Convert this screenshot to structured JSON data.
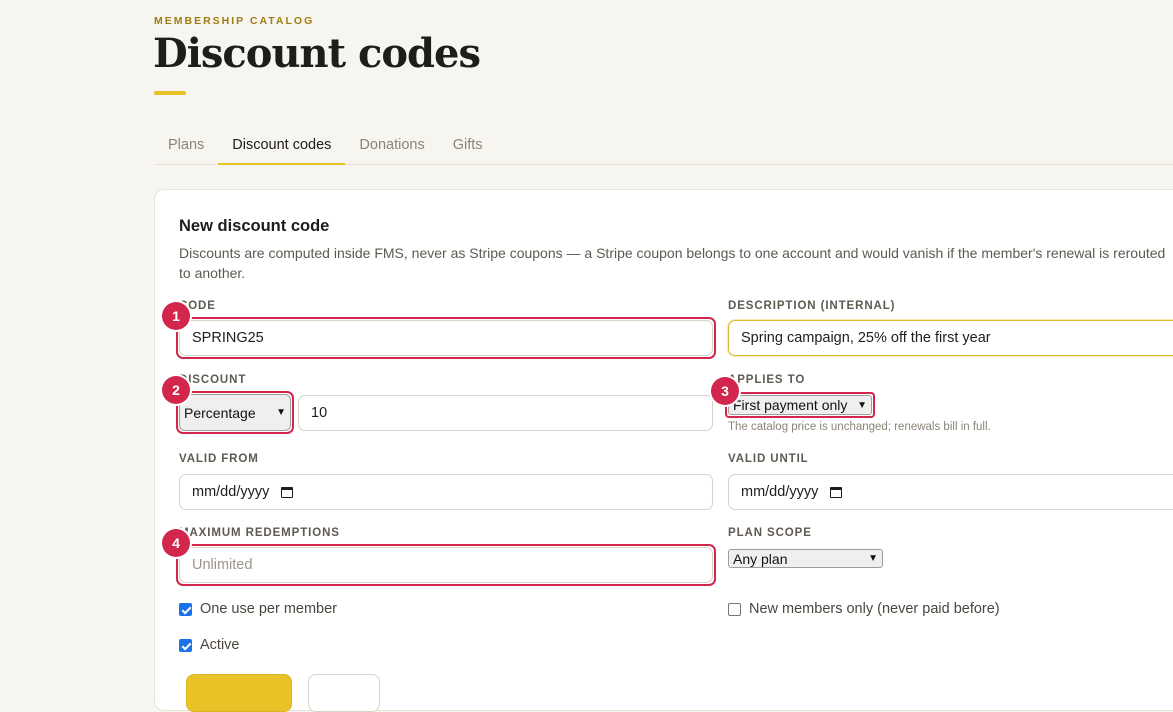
{
  "header": {
    "eyebrow": "MEMBERSHIP CATALOG",
    "title": "Discount codes"
  },
  "tabs": [
    {
      "label": "Plans",
      "active": false
    },
    {
      "label": "Discount codes",
      "active": true
    },
    {
      "label": "Donations",
      "active": false
    },
    {
      "label": "Gifts",
      "active": false
    }
  ],
  "form": {
    "title": "New discount code",
    "description": "Discounts are computed inside FMS, never as Stripe coupons — a Stripe coupon belongs to one account and would vanish if the member's renewal is rerouted to another.",
    "code": {
      "label": "CODE",
      "value": "SPRING25",
      "badge": "1"
    },
    "description_internal": {
      "label": "DESCRIPTION (INTERNAL)",
      "value": "Spring campaign, 25% off the first year"
    },
    "discount": {
      "label": "DISCOUNT",
      "type": "Percentage",
      "amount": "10",
      "badge": "2"
    },
    "applies_to": {
      "label": "APPLIES TO",
      "value": "First payment only",
      "hint": "The catalog price is unchanged; renewals bill in full.",
      "badge": "3"
    },
    "valid_from": {
      "label": "VALID FROM",
      "placeholder": "mm/dd/yyyy"
    },
    "valid_until": {
      "label": "VALID UNTIL",
      "placeholder": "mm/dd/yyyy"
    },
    "max_redemptions": {
      "label": "MAXIMUM REDEMPTIONS",
      "placeholder": "Unlimited",
      "badge": "4"
    },
    "plan_scope": {
      "label": "PLAN SCOPE",
      "value": "Any plan"
    },
    "checkboxes": {
      "one_use": {
        "label": "One use per member",
        "checked": true
      },
      "new_members": {
        "label": "New members only (never paid before)",
        "checked": false
      },
      "active": {
        "label": "Active",
        "checked": true
      }
    }
  },
  "colors": {
    "accent": "#e9c227",
    "eyebrow": "#a07d12",
    "highlight": "#d3264d",
    "background": "#f7f5f0"
  }
}
